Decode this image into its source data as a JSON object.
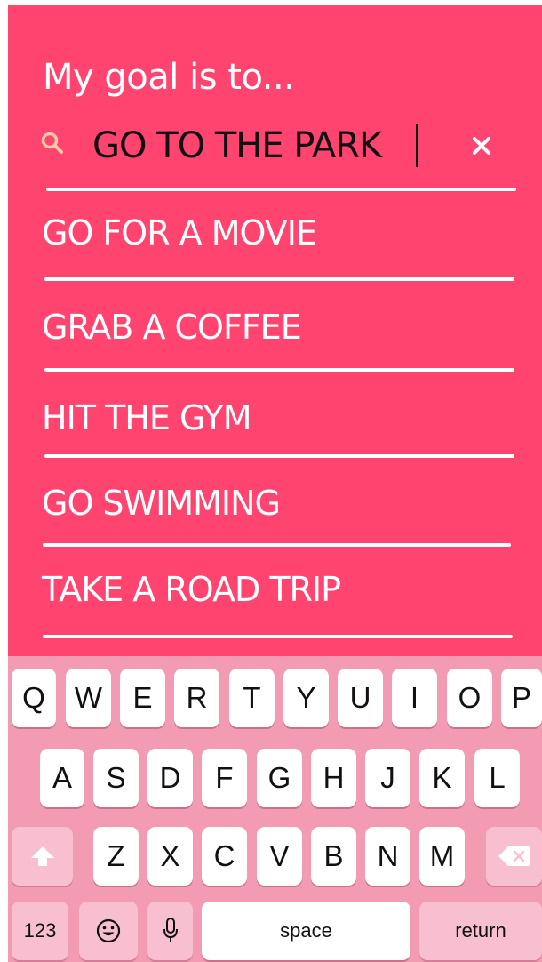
{
  "header": {
    "prompt": "My goal is to..."
  },
  "search": {
    "value": "GO TO THE PARK",
    "icon": "search-icon",
    "clear_icon": "close-icon"
  },
  "suggestions": [
    {
      "label": "GO FOR A MOVIE"
    },
    {
      "label": "GRAB A COFFEE"
    },
    {
      "label": "HIT THE GYM"
    },
    {
      "label": "GO SWIMMING"
    },
    {
      "label": "TAKE A ROAD TRIP"
    }
  ],
  "keyboard": {
    "row1": [
      "Q",
      "W",
      "E",
      "R",
      "T",
      "Y",
      "U",
      "I",
      "O",
      "P"
    ],
    "row2": [
      "A",
      "S",
      "D",
      "F",
      "G",
      "H",
      "J",
      "K",
      "L"
    ],
    "row3": [
      "Z",
      "X",
      "C",
      "V",
      "B",
      "N",
      "M"
    ],
    "numbers_label": "123",
    "space_label": "space",
    "return_label": "return",
    "shift_icon": "shift-icon",
    "delete_icon": "delete-icon",
    "emoji_icon": "emoji-icon",
    "mic_icon": "microphone-icon"
  },
  "colors": {
    "panel": "#ff4470",
    "keyboard_bg": "#f29bb3",
    "key_bg": "#ffffff",
    "special_key_bg": "#f7bfd0",
    "text_light": "#ffffff",
    "text_dark": "#111111"
  }
}
